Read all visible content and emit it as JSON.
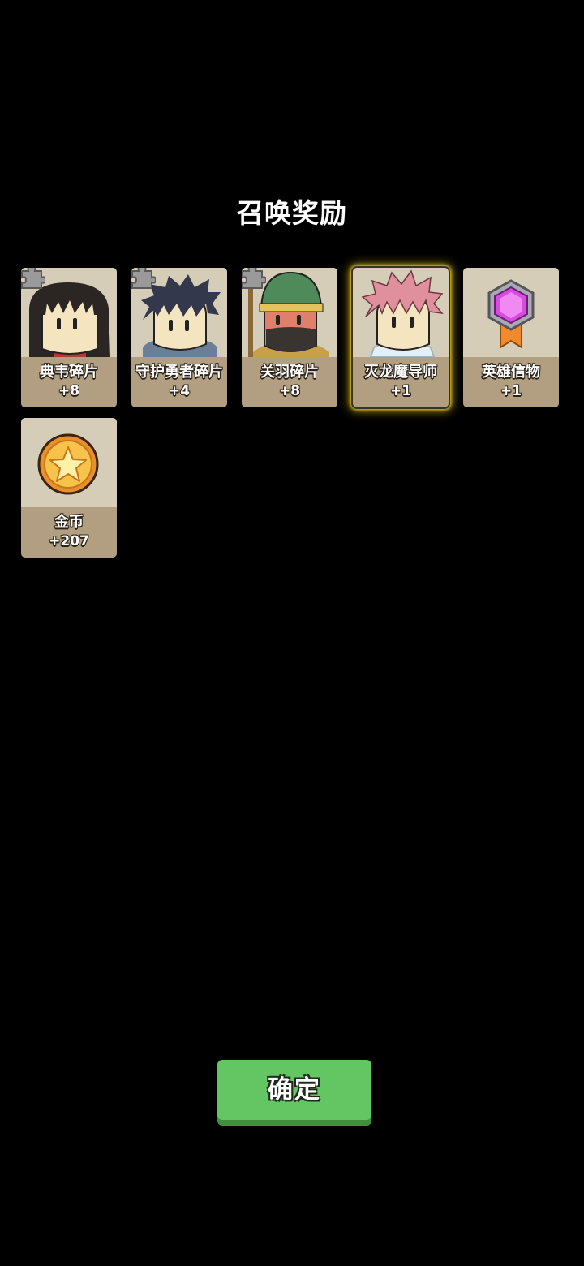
{
  "title": "召唤奖励",
  "rewards": [
    {
      "name": "典韦碎片",
      "count": "+8",
      "icon": "hero-dianwei-portrait-icon",
      "fragment": true
    },
    {
      "name": "守护勇者碎片",
      "count": "+4",
      "icon": "hero-guardian-portrait-icon",
      "fragment": true
    },
    {
      "name": "关羽碎片",
      "count": "+8",
      "icon": "hero-guanyu-portrait-icon",
      "fragment": true
    },
    {
      "name": "灭龙魔导师",
      "count": "+1",
      "icon": "hero-dragon-mage-portrait-icon",
      "fragment": false,
      "highlighted": true
    },
    {
      "name": "英雄信物",
      "count": "+1",
      "icon": "purple-gem-medal-icon",
      "fragment": false
    },
    {
      "name": "金币",
      "count": "+207",
      "icon": "gold-coin-star-icon",
      "fragment": false
    }
  ],
  "confirm_label": "确定",
  "colors": {
    "background": "#000000",
    "card_bottom": "#b29e81",
    "card_top": "#d6cdb8",
    "highlight_glow": "#f4d21c",
    "confirm_button": "#63c663"
  }
}
